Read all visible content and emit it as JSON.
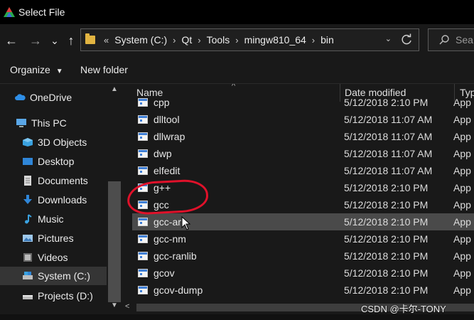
{
  "window": {
    "title": "Select File"
  },
  "nav": {
    "back_glyph": "←",
    "forward_glyph": "→",
    "recent_glyph": "⌄",
    "up_glyph": "↑",
    "breadcrumb_prefix": "«",
    "breadcrumbs": [
      "System (C:)",
      "Qt",
      "Tools",
      "mingw810_64",
      "bin"
    ],
    "separator": "›"
  },
  "search": {
    "placeholder": "Sea"
  },
  "toolbar": {
    "organize": "Organize",
    "new_folder": "New folder"
  },
  "sidebar": {
    "items": [
      {
        "label": "OneDrive",
        "icon": "cloud-icon"
      },
      {
        "label": "This PC",
        "icon": "computer-icon"
      },
      {
        "label": "3D Objects",
        "icon": "cube-icon"
      },
      {
        "label": "Desktop",
        "icon": "desktop-icon"
      },
      {
        "label": "Documents",
        "icon": "document-icon"
      },
      {
        "label": "Downloads",
        "icon": "download-icon"
      },
      {
        "label": "Music",
        "icon": "music-icon"
      },
      {
        "label": "Pictures",
        "icon": "pictures-icon"
      },
      {
        "label": "Videos",
        "icon": "videos-icon"
      },
      {
        "label": "System (C:)",
        "icon": "drive-icon",
        "selected": true
      },
      {
        "label": "Projects (D:)",
        "icon": "drive-icon"
      }
    ]
  },
  "list": {
    "columns": {
      "name": "Name",
      "date": "Date modified",
      "type": "Typ"
    },
    "rows": [
      {
        "name": "cpp",
        "date": "5/12/2018 2:10 PM",
        "type": "App"
      },
      {
        "name": "dlltool",
        "date": "5/12/2018 11:07 AM",
        "type": "App"
      },
      {
        "name": "dllwrap",
        "date": "5/12/2018 11:07 AM",
        "type": "App"
      },
      {
        "name": "dwp",
        "date": "5/12/2018 11:07 AM",
        "type": "App"
      },
      {
        "name": "elfedit",
        "date": "5/12/2018 11:07 AM",
        "type": "App"
      },
      {
        "name": "g++",
        "date": "5/12/2018 2:10 PM",
        "type": "App"
      },
      {
        "name": "gcc",
        "date": "5/12/2018 2:10 PM",
        "type": "App"
      },
      {
        "name": "gcc-ar",
        "date": "5/12/2018 2:10 PM",
        "type": "App",
        "hover": true
      },
      {
        "name": "gcc-nm",
        "date": "5/12/2018 2:10 PM",
        "type": "App"
      },
      {
        "name": "gcc-ranlib",
        "date": "5/12/2018 2:10 PM",
        "type": "App"
      },
      {
        "name": "gcov",
        "date": "5/12/2018 2:10 PM",
        "type": "App"
      },
      {
        "name": "gcov-dump",
        "date": "5/12/2018 2:10 PM",
        "type": "App"
      }
    ]
  },
  "watermark": "CSDN @卡尔-TONY",
  "colors": {
    "accent": "#3f7fd6",
    "folder": "#e2b441",
    "annotation": "#e0112a"
  }
}
